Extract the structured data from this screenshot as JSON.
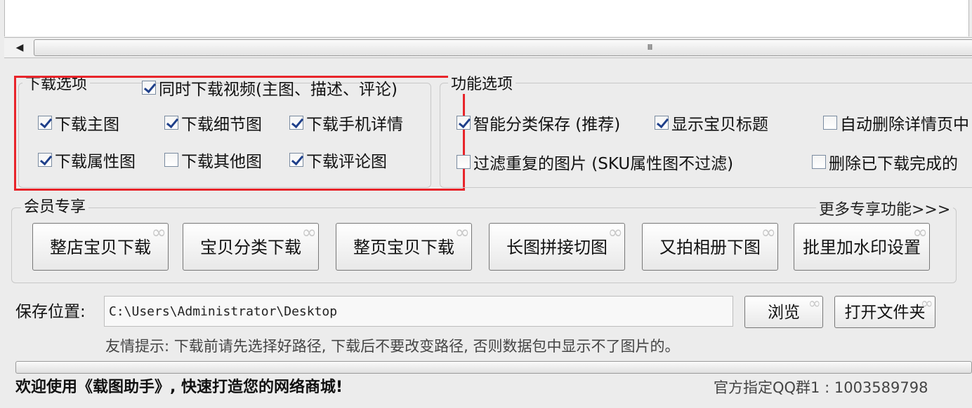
{
  "scrollbar": {
    "grip": "III"
  },
  "download_options": {
    "legend": "下载选项",
    "video_checkbox": {
      "label": "同时下载视频(主图、描述、评论)",
      "checked": true
    },
    "items": [
      {
        "label": "下载主图",
        "checked": true
      },
      {
        "label": "下载细节图",
        "checked": true
      },
      {
        "label": "下载手机详情",
        "checked": true
      },
      {
        "label": "下载属性图",
        "checked": true
      },
      {
        "label": "下载其他图",
        "checked": false
      },
      {
        "label": "下载评论图",
        "checked": true
      }
    ]
  },
  "function_options": {
    "legend": "功能选项",
    "items": [
      {
        "label": "智能分类保存 (推荐)",
        "checked": true
      },
      {
        "label": "显示宝贝标题",
        "checked": true
      },
      {
        "label": "自动删除详情页中",
        "checked": false
      },
      {
        "label": "过滤重复的图片 (SKU属性图不过滤)",
        "checked": false
      },
      {
        "label": "删除已下载完成的",
        "checked": false
      }
    ]
  },
  "member": {
    "legend": "会员专享",
    "more_link": "更多专享功能>>>",
    "buttons": [
      "整店宝贝下载",
      "宝贝分类下载",
      "整页宝贝下载",
      "长图拼接切图",
      "又拍相册下图",
      "批里加水印设置"
    ]
  },
  "save": {
    "label": "保存位置:",
    "path": "C:\\Users\\Administrator\\Desktop",
    "browse_label": "浏览",
    "open_folder_label": "打开文件夹"
  },
  "tip": "友情提示: 下载前请先选择好路径, 下载后不要改变路径, 否则数据包中显示不了图片的。",
  "status": {
    "welcome": "欢迎使用《载图助手》, 快速打造您的网络商城!",
    "qq_group": "官方指定QQ群1 : 1003589798"
  }
}
